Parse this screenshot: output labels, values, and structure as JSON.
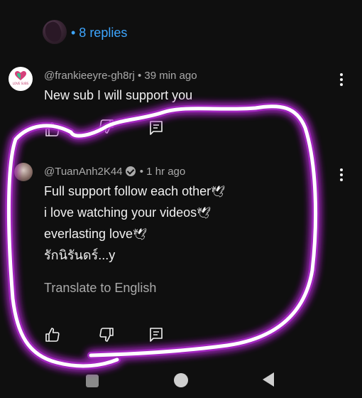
{
  "replies": {
    "label": "• 8 replies"
  },
  "comment1": {
    "author": "@frankieeyre-gh8rj",
    "time": " • 39 min ago",
    "text": "New sub I will support you",
    "avatar_text": "LOVE SUBS"
  },
  "comment2": {
    "author": "@TuanAnh2K44",
    "time": "• 1 hr ago",
    "lines": [
      "Full support follow each other",
      "i love watching your videos",
      "everlasting love",
      "รักนิรันดร์...y"
    ],
    "dove": "🕊",
    "translate_label": "Translate to English"
  },
  "icons": {
    "like": "thumbs-up-icon",
    "dislike": "thumbs-down-icon",
    "reply": "comment-icon",
    "more": "more-vertical-icon",
    "verified": "verified-check-icon"
  },
  "colors": {
    "background": "#0f0f0f",
    "link": "#3ea6ff",
    "secondary_text": "#aaaaaa",
    "highlight": "#c23bd4"
  }
}
